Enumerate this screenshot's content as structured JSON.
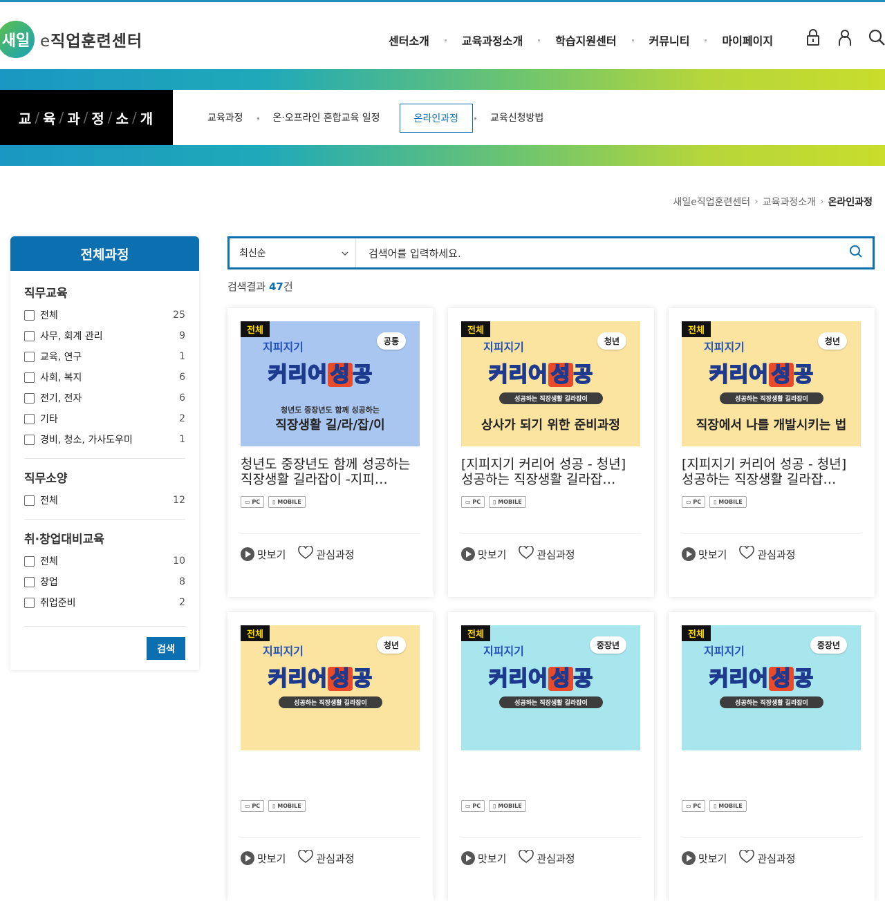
{
  "header": {
    "logo_mark": "새일",
    "logo_text": "e직업훈련센터",
    "gnb": [
      "센터소개",
      "교육과정소개",
      "학습지원센터",
      "커뮤니티",
      "마이페이지"
    ],
    "util_icons": [
      "lock-icon",
      "user-icon",
      "search-icon"
    ]
  },
  "subnav": {
    "title_chars": [
      "교",
      "육",
      "과",
      "정",
      "소",
      "개"
    ],
    "items": [
      "교육과정",
      "온·오프라인 혼합교육 일정",
      "온라인과정",
      "교육신청방법"
    ],
    "active": "온라인과정"
  },
  "breadcrumb": [
    "새일e직업훈련센터",
    "교육과정소개",
    "온라인과정"
  ],
  "sidebar": {
    "title": "전체과정",
    "groups": [
      {
        "name": "직무교육",
        "items": [
          {
            "label": "전체",
            "count": "25"
          },
          {
            "label": "사무, 회계 관리",
            "count": "9"
          },
          {
            "label": "교육, 연구",
            "count": "1"
          },
          {
            "label": "사회, 복지",
            "count": "6"
          },
          {
            "label": "전기, 전자",
            "count": "6"
          },
          {
            "label": "기타",
            "count": "2"
          },
          {
            "label": "경비, 청소, 가사도우미",
            "count": "1"
          }
        ]
      },
      {
        "name": "직무소양",
        "items": [
          {
            "label": "전체",
            "count": "12"
          }
        ]
      },
      {
        "name": "취·창업대비교육",
        "items": [
          {
            "label": "전체",
            "count": "10"
          },
          {
            "label": "창업",
            "count": "8"
          },
          {
            "label": "취업준비",
            "count": "2"
          }
        ]
      }
    ],
    "search_label": "검색"
  },
  "search": {
    "sort_value": "최신순",
    "placeholder": "검색어를 입력하세요.",
    "result_prefix": "검색결과 ",
    "result_count": "47",
    "result_suffix": "건"
  },
  "card_common": {
    "badge": "전체",
    "brand": "지피지기",
    "big_left": "커리어",
    "big_mid": "성",
    "big_right": "공",
    "pill": "성공하는 직장생활 길라잡이",
    "dev_pc": "PC",
    "dev_mobile": "MOBILE",
    "preview": "맛보기",
    "interest": "관심과정"
  },
  "cards": [
    {
      "tag": "공통",
      "bg": "#a9c6f0",
      "sub1": "청년도 중장년도 함께 성공하는",
      "sub2": "직장생활 길/라/잡/이",
      "show_pill": false,
      "title": "청년도 중장년도 함께 성공하는 직장생활 길라잡이 -지피…"
    },
    {
      "tag": "청년",
      "bg": "#fbe3a0",
      "sub1": "",
      "sub2": "상사가 되기 위한 준비과정",
      "show_pill": true,
      "title": "[지피지기 커리어 성공 - 청년] 성공하는 직장생활 길라잡…"
    },
    {
      "tag": "청년",
      "bg": "#fbe3a0",
      "sub1": "",
      "sub2": "직장에서 나를 개발시키는 법",
      "show_pill": true,
      "title": "[지피지기 커리어 성공 - 청년] 성공하는 직장생활 길라잡…"
    },
    {
      "tag": "청년",
      "bg": "#fbe3a0",
      "sub1": "",
      "sub2": "",
      "show_pill": true,
      "title": ""
    },
    {
      "tag": "중장년",
      "bg": "#a8e6ee",
      "sub1": "",
      "sub2": "",
      "show_pill": true,
      "title": ""
    },
    {
      "tag": "중장년",
      "bg": "#a8e6ee",
      "sub1": "",
      "sub2": "",
      "show_pill": true,
      "title": ""
    }
  ],
  "colors": {
    "primary": "#0b6fb0",
    "band_start": "#1a97c2",
    "band_end": "#c8dd2c"
  }
}
